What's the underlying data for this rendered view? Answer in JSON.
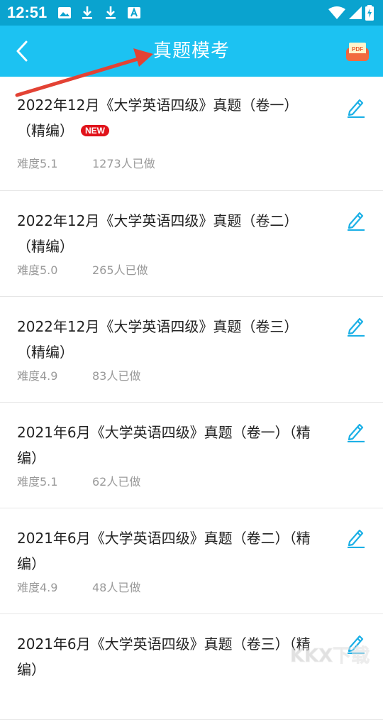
{
  "status_bar": {
    "time": "12:51",
    "left_icons": [
      "image-icon",
      "download-icon",
      "download-icon",
      "font-icon"
    ],
    "right_icons": [
      "wifi-icon",
      "signal-icon",
      "battery-charging-icon"
    ]
  },
  "app_bar": {
    "title": "真题模考",
    "back_icon": "chevron-left-icon",
    "pdf_icon": "pdf-icon",
    "pdf_label": "PDF",
    "background": "#1cc2f2"
  },
  "items": [
    {
      "title": "2022年12月《大学英语四级》真题（卷一）（精编）",
      "badge": "NEW",
      "difficulty": "难度5.1",
      "done": "1273人已做"
    },
    {
      "title": "2022年12月《大学英语四级》真题（卷二）（精编）",
      "badge": "",
      "difficulty": "难度5.0",
      "done": "265人已做"
    },
    {
      "title": "2022年12月《大学英语四级》真题（卷三）（精编）",
      "badge": "",
      "difficulty": "难度4.9",
      "done": "83人已做"
    },
    {
      "title": "2021年6月《大学英语四级》真题（卷一）（精编）",
      "badge": "",
      "difficulty": "难度5.1",
      "done": "62人已做"
    },
    {
      "title": "2021年6月《大学英语四级》真题（卷二）（精编）",
      "badge": "",
      "difficulty": "难度4.9",
      "done": "48人已做"
    },
    {
      "title": "2021年6月《大学英语四级》真题（卷三）（精编）",
      "badge": "",
      "difficulty": "",
      "done": ""
    }
  ],
  "colors": {
    "accent": "#1cc2f2",
    "badge": "#e1131b",
    "annotation_arrow": "#e34234"
  },
  "watermark_text": "KKX下载"
}
